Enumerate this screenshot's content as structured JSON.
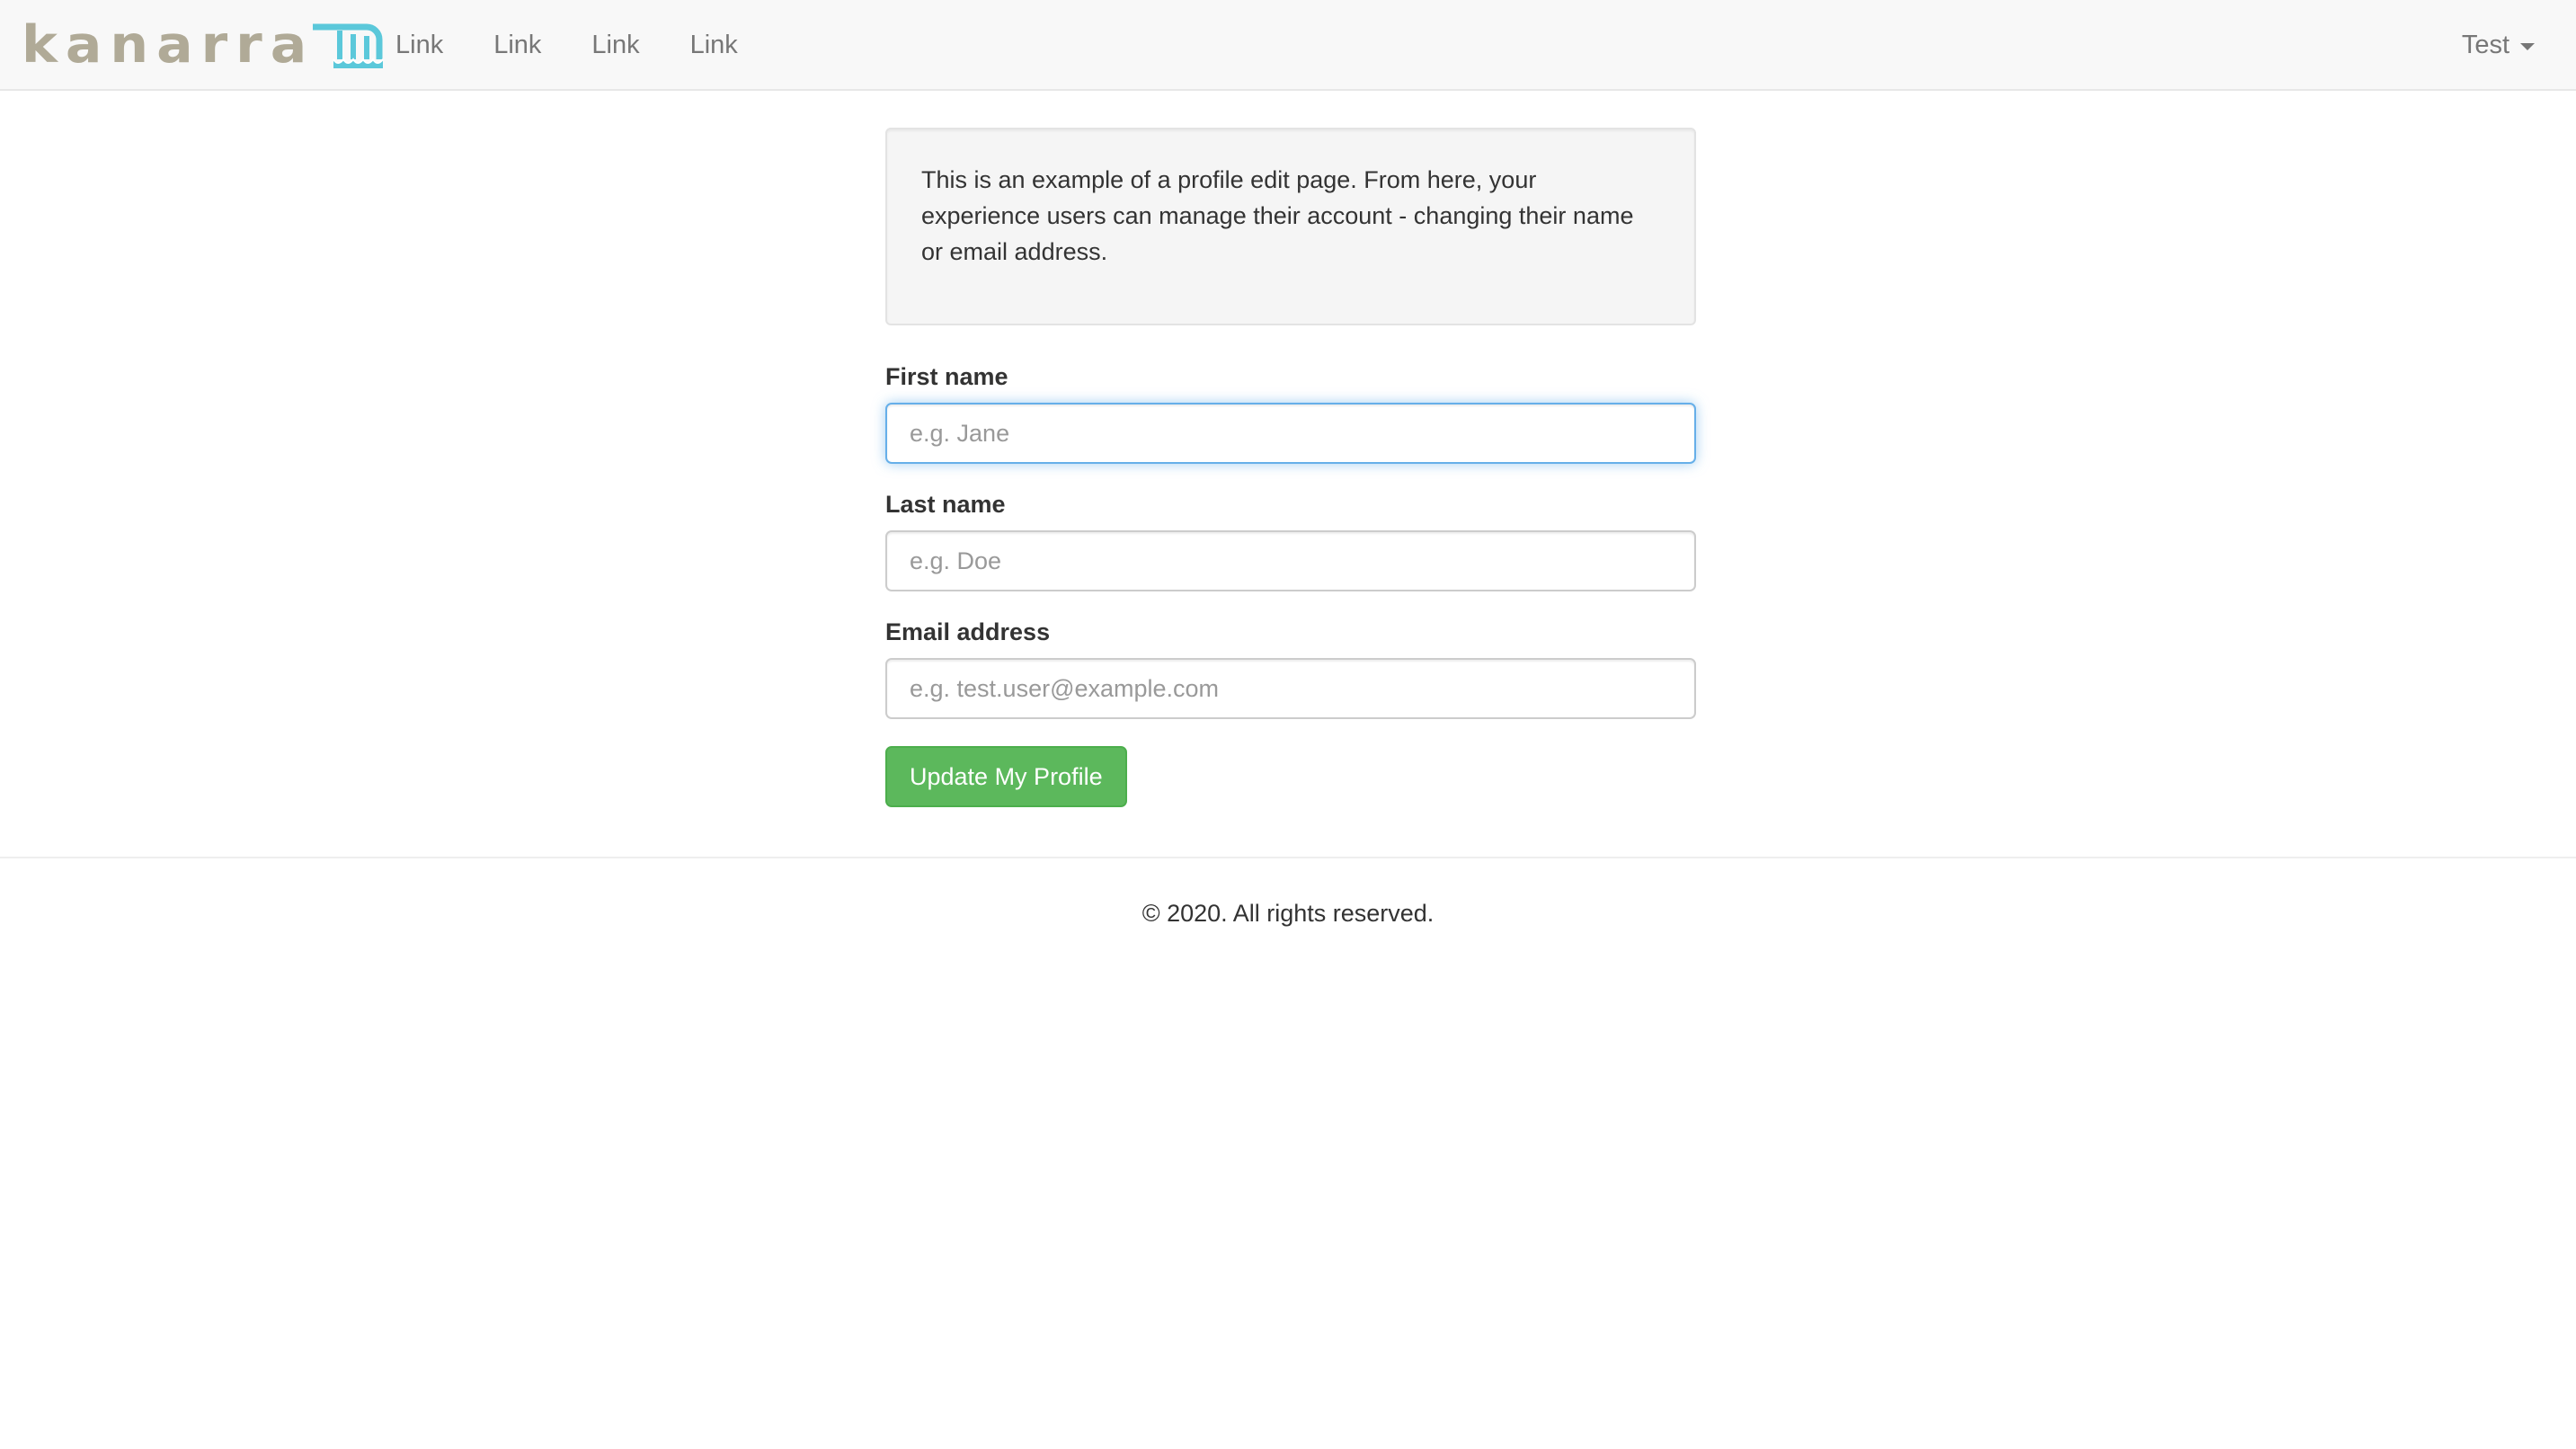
{
  "navbar": {
    "brand": {
      "text": "kanarra",
      "icon": "waterfall-logo-icon",
      "text_color": "#b0aa97",
      "icon_color": "#5bc8da"
    },
    "links": [
      {
        "label": "Link"
      },
      {
        "label": "Link"
      },
      {
        "label": "Link"
      },
      {
        "label": "Link"
      }
    ],
    "user_menu": {
      "label": "Test",
      "icon": "caret-down-icon"
    }
  },
  "intro": {
    "text": "This is an example of a profile edit page. From here, your experience users can manage their account - changing their name or email address."
  },
  "form": {
    "first_name": {
      "label": "First name",
      "value": "",
      "placeholder": "e.g. Jane",
      "focused": true
    },
    "last_name": {
      "label": "Last name",
      "value": "",
      "placeholder": "e.g. Doe"
    },
    "email": {
      "label": "Email address",
      "value": "",
      "placeholder": "e.g. test.user@example.com"
    },
    "submit_label": "Update My Profile",
    "submit_color": "#5cb85c"
  },
  "footer": {
    "text": "© 2020. All rights reserved."
  }
}
